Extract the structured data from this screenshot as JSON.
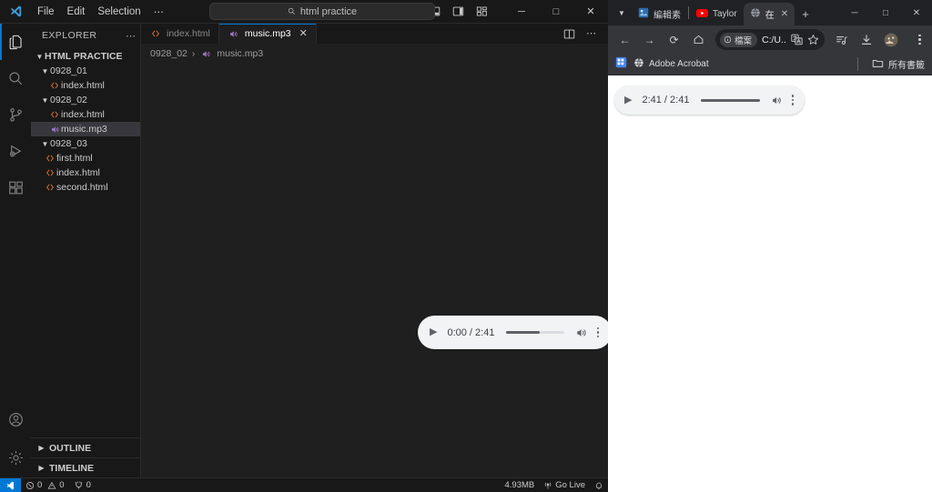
{
  "vscode": {
    "menu": [
      "File",
      "Edit",
      "Selection",
      "⋯"
    ],
    "nav": {
      "back": "←",
      "forward": "→"
    },
    "search": {
      "value": "html practice",
      "icon": "search-icon"
    },
    "layout_icons": [
      "toggle-primary-sidebar-icon",
      "toggle-panel-icon",
      "toggle-secondary-sidebar-icon",
      "customize-layout-icon"
    ],
    "window_controls": {
      "minimize": "─",
      "maximize": "□",
      "close": "✕"
    },
    "activitybar": [
      {
        "name": "explorer",
        "icon": "files-icon",
        "active": true
      },
      {
        "name": "search",
        "icon": "search-icon",
        "active": false
      },
      {
        "name": "source-control",
        "icon": "source-control-icon",
        "active": false
      },
      {
        "name": "run-debug",
        "icon": "run-and-debug-icon",
        "active": false
      },
      {
        "name": "extensions",
        "icon": "extensions-icon",
        "active": false
      }
    ],
    "activitybar_bottom": [
      {
        "name": "accounts",
        "icon": "account-icon"
      },
      {
        "name": "settings",
        "icon": "gear-icon"
      }
    ],
    "sidebar": {
      "title": "EXPLORER",
      "more": "⋯",
      "tree": [
        {
          "label": "HTML PRACTICE",
          "type": "root",
          "expanded": true,
          "depth": 0
        },
        {
          "label": "0928_01",
          "type": "folder",
          "expanded": true,
          "depth": 1
        },
        {
          "label": "index.html",
          "type": "html",
          "depth": 2
        },
        {
          "label": "0928_02",
          "type": "folder",
          "expanded": true,
          "depth": 1
        },
        {
          "label": "index.html",
          "type": "html",
          "depth": 2
        },
        {
          "label": "music.mp3",
          "type": "audio",
          "depth": 2,
          "selected": true
        },
        {
          "label": "0928_03",
          "type": "folder",
          "expanded": true,
          "depth": 1
        },
        {
          "label": "first.html",
          "type": "html",
          "depth": 2,
          "tight": true
        },
        {
          "label": "index.html",
          "type": "html",
          "depth": 2,
          "tight": true
        },
        {
          "label": "second.html",
          "type": "html",
          "depth": 2,
          "tight": true
        }
      ],
      "sections": [
        {
          "label": "OUTLINE",
          "expanded": false
        },
        {
          "label": "TIMELINE",
          "expanded": false
        }
      ]
    },
    "tabs": [
      {
        "label": "index.html",
        "icon": "html-file-icon",
        "active": false,
        "closable": false
      },
      {
        "label": "music.mp3",
        "icon": "audio-file-icon",
        "active": true,
        "closable": true,
        "close": "✕"
      }
    ],
    "editor_actions": [
      "split-editor-icon",
      "more-actions-icon"
    ],
    "breadcrumb": {
      "folder": "0928_02",
      "separator": "›",
      "file": "music.mp3",
      "icon": "audio-file-icon"
    },
    "audio_player": {
      "play_label": "▶",
      "time": "0:00 / 2:41",
      "progress_percent": 58,
      "volume_icon": "volume-on-icon",
      "more_icon": "more-vertical-icon"
    },
    "statusbar": {
      "remote_icon": "remote-window-icon",
      "errors": "0",
      "warnings": "0",
      "ports": "0",
      "size": "4.93MB",
      "golive": "Go Live",
      "bell_icon": "notifications-icon"
    }
  },
  "browser": {
    "tablist_icon": "tab-search-icon",
    "tabs": [
      {
        "label": "編輯素",
        "icon": "image-editor-icon",
        "active": false
      },
      {
        "label": "Taylor",
        "icon": "youtube-icon",
        "active": false
      },
      {
        "label": "在",
        "icon": "globe-icon",
        "active": true,
        "close": "✕"
      }
    ],
    "newtab": "+",
    "window_controls": {
      "minimize": "─",
      "maximize": "□",
      "close": "✕"
    },
    "toolbar": {
      "back": "←",
      "forward": "→",
      "reload": "⟳",
      "home": "⌂",
      "badge_label": "檔案",
      "badge_icon": "info-circle-icon",
      "url": "C:/U...",
      "translate_icon": "translate-icon",
      "bookmark_icon": "star-icon",
      "media_icon": "media-control-icon",
      "downloads_icon": "downloads-icon",
      "profile_icon": "profile-avatar-icon",
      "menu_icon": "three-dot-menu-icon"
    },
    "bookmarks": {
      "apps_icon": "apps-grid-icon",
      "items": [
        {
          "label": "Adobe Acrobat",
          "icon": "globe-icon"
        }
      ],
      "all_bookmarks": {
        "label": "所有書籤",
        "icon": "folder-icon"
      }
    },
    "audio_player": {
      "play_label": "▶",
      "time": "2:41 / 2:41",
      "progress_percent": 100,
      "volume_icon": "volume-on-icon",
      "more_icon": "more-vertical-icon"
    }
  }
}
